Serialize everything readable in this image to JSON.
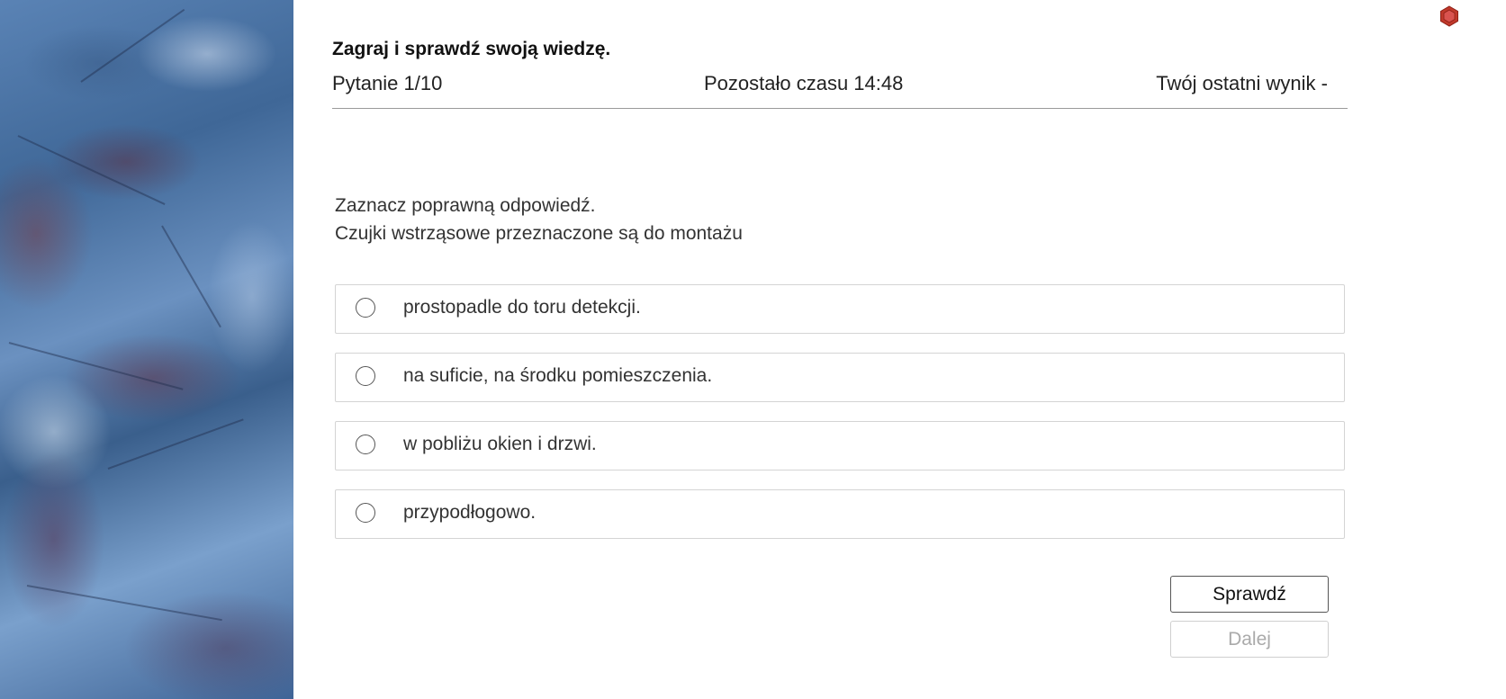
{
  "header": {
    "title": "Zagraj i sprawdź swoją wiedzę.",
    "question_counter": "Pytanie 1/10",
    "timer": "Pozostało czasu 14:48",
    "last_score": "Twój ostatni wynik -"
  },
  "question": {
    "instruction": "Zaznacz poprawną odpowiedź.",
    "text": "Czujki wstrząsowe przeznaczone są do montażu"
  },
  "answers": [
    {
      "label": "prostopadle do toru detekcji.",
      "selected": false
    },
    {
      "label": "na suficie, na środku pomieszczenia.",
      "selected": false
    },
    {
      "label": "w pobliżu okien i drzwi.",
      "selected": false
    },
    {
      "label": "przypodłogowo.",
      "selected": false
    }
  ],
  "buttons": {
    "check_label": "Sprawdź",
    "next_label": "Dalej",
    "next_disabled": true
  },
  "icons": {
    "corner_icon": "hexagon-icon",
    "corner_icon_color": "#c0392b"
  },
  "colors": {
    "side_image_primary": "#4a72a5",
    "divider": "#9a9a9a",
    "answer_border": "#d4d4d4"
  }
}
